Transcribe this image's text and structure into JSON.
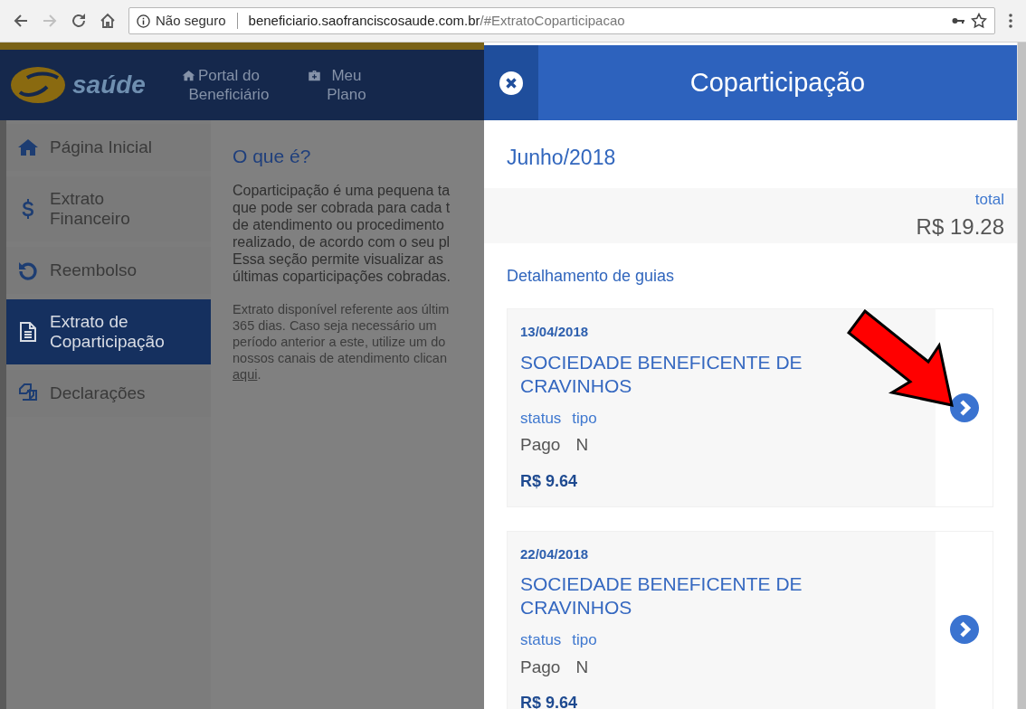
{
  "browser": {
    "back": {
      "disabled": false
    },
    "forward": {
      "disabled": true
    },
    "security_label": "Não seguro",
    "url_host": "beneficiario.saofranciscosaude.com.br",
    "url_path": "/#ExtratoCoparticipacao"
  },
  "header": {
    "logo_text": "saúde",
    "nav": [
      {
        "label": "Portal do Beneficiário"
      },
      {
        "label": "Meu Plano"
      }
    ]
  },
  "sidebar": {
    "items": [
      {
        "label": "Página Inicial",
        "selected": false
      },
      {
        "label": "Extrato Financeiro",
        "selected": false
      },
      {
        "label": "Reembolso",
        "selected": false
      },
      {
        "label": "Extrato de Coparticipação",
        "selected": true
      },
      {
        "label": "Declarações",
        "selected": false
      }
    ]
  },
  "content": {
    "heading": "O que é?",
    "description": "Coparticipação é uma pequena ta\nque pode ser cobrada para cada t\nde atendimento ou procedimento\nrealizado, de acordo com o seu pl\nEssa seção permite visualizar as\núltimas coparticipações cobradas.",
    "notice": "Extrato disponível referente aos últim\n365 dias. Caso seja necessário um\nperíodo anterior a este, utilize um do\nnossos canais de atendimento clican\n",
    "notice_link": "aqui",
    "notice_end": "."
  },
  "drawer": {
    "title": "Coparticipação",
    "month": "Junho/2018",
    "total_label": "total",
    "total_value": "R$ 19.28",
    "section_title": "Detalhamento de guias",
    "guides": [
      {
        "date": "13/04/2018",
        "provider": "SOCIEDADE BENEFICENTE DE CRAVINHOS",
        "status_label": "status",
        "type_label": "tipo",
        "status": "Pago",
        "type": "N",
        "amount": "R$ 9.64"
      },
      {
        "date": "22/04/2018",
        "provider": "SOCIEDADE BENEFICENTE DE CRAVINHOS",
        "status_label": "status",
        "type_label": "tipo",
        "status": "Pago",
        "type": "N",
        "amount": "R$ 9.64"
      }
    ]
  }
}
